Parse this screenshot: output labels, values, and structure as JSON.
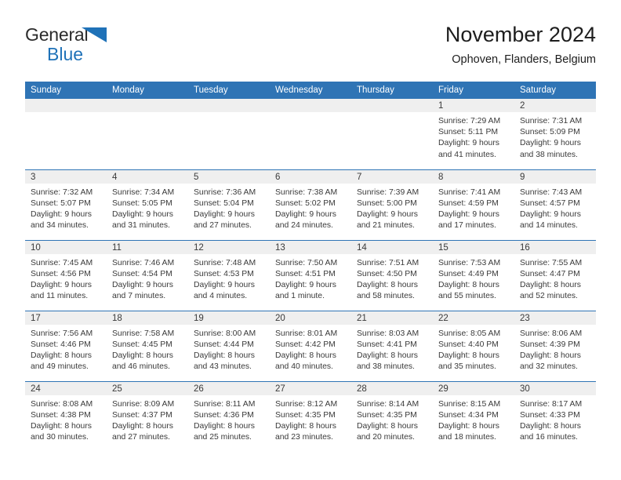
{
  "brand": {
    "line1": "General",
    "line2": "Blue",
    "triangle_color": "#1f72b8"
  },
  "header": {
    "title": "November 2024",
    "subtitle": "Ophoven, Flanders, Belgium"
  },
  "colors": {
    "header_blue": "#2f74b5",
    "daynum_gray": "#efefef",
    "text": "#3a3a3a"
  },
  "weekdays": [
    "Sunday",
    "Monday",
    "Tuesday",
    "Wednesday",
    "Thursday",
    "Friday",
    "Saturday"
  ],
  "labels": {
    "sunrise": "Sunrise:",
    "sunset": "Sunset:",
    "daylight": "Daylight:"
  },
  "weeks": [
    [
      {
        "day": "",
        "empty": true
      },
      {
        "day": "",
        "empty": true
      },
      {
        "day": "",
        "empty": true
      },
      {
        "day": "",
        "empty": true
      },
      {
        "day": "",
        "empty": true
      },
      {
        "day": "1",
        "sunrise": "Sunrise: 7:29 AM",
        "sunset": "Sunset: 5:11 PM",
        "daylight1": "Daylight: 9 hours",
        "daylight2": "and 41 minutes."
      },
      {
        "day": "2",
        "sunrise": "Sunrise: 7:31 AM",
        "sunset": "Sunset: 5:09 PM",
        "daylight1": "Daylight: 9 hours",
        "daylight2": "and 38 minutes."
      }
    ],
    [
      {
        "day": "3",
        "sunrise": "Sunrise: 7:32 AM",
        "sunset": "Sunset: 5:07 PM",
        "daylight1": "Daylight: 9 hours",
        "daylight2": "and 34 minutes."
      },
      {
        "day": "4",
        "sunrise": "Sunrise: 7:34 AM",
        "sunset": "Sunset: 5:05 PM",
        "daylight1": "Daylight: 9 hours",
        "daylight2": "and 31 minutes."
      },
      {
        "day": "5",
        "sunrise": "Sunrise: 7:36 AM",
        "sunset": "Sunset: 5:04 PM",
        "daylight1": "Daylight: 9 hours",
        "daylight2": "and 27 minutes."
      },
      {
        "day": "6",
        "sunrise": "Sunrise: 7:38 AM",
        "sunset": "Sunset: 5:02 PM",
        "daylight1": "Daylight: 9 hours",
        "daylight2": "and 24 minutes."
      },
      {
        "day": "7",
        "sunrise": "Sunrise: 7:39 AM",
        "sunset": "Sunset: 5:00 PM",
        "daylight1": "Daylight: 9 hours",
        "daylight2": "and 21 minutes."
      },
      {
        "day": "8",
        "sunrise": "Sunrise: 7:41 AM",
        "sunset": "Sunset: 4:59 PM",
        "daylight1": "Daylight: 9 hours",
        "daylight2": "and 17 minutes."
      },
      {
        "day": "9",
        "sunrise": "Sunrise: 7:43 AM",
        "sunset": "Sunset: 4:57 PM",
        "daylight1": "Daylight: 9 hours",
        "daylight2": "and 14 minutes."
      }
    ],
    [
      {
        "day": "10",
        "sunrise": "Sunrise: 7:45 AM",
        "sunset": "Sunset: 4:56 PM",
        "daylight1": "Daylight: 9 hours",
        "daylight2": "and 11 minutes."
      },
      {
        "day": "11",
        "sunrise": "Sunrise: 7:46 AM",
        "sunset": "Sunset: 4:54 PM",
        "daylight1": "Daylight: 9 hours",
        "daylight2": "and 7 minutes."
      },
      {
        "day": "12",
        "sunrise": "Sunrise: 7:48 AM",
        "sunset": "Sunset: 4:53 PM",
        "daylight1": "Daylight: 9 hours",
        "daylight2": "and 4 minutes."
      },
      {
        "day": "13",
        "sunrise": "Sunrise: 7:50 AM",
        "sunset": "Sunset: 4:51 PM",
        "daylight1": "Daylight: 9 hours",
        "daylight2": "and 1 minute."
      },
      {
        "day": "14",
        "sunrise": "Sunrise: 7:51 AM",
        "sunset": "Sunset: 4:50 PM",
        "daylight1": "Daylight: 8 hours",
        "daylight2": "and 58 minutes."
      },
      {
        "day": "15",
        "sunrise": "Sunrise: 7:53 AM",
        "sunset": "Sunset: 4:49 PM",
        "daylight1": "Daylight: 8 hours",
        "daylight2": "and 55 minutes."
      },
      {
        "day": "16",
        "sunrise": "Sunrise: 7:55 AM",
        "sunset": "Sunset: 4:47 PM",
        "daylight1": "Daylight: 8 hours",
        "daylight2": "and 52 minutes."
      }
    ],
    [
      {
        "day": "17",
        "sunrise": "Sunrise: 7:56 AM",
        "sunset": "Sunset: 4:46 PM",
        "daylight1": "Daylight: 8 hours",
        "daylight2": "and 49 minutes."
      },
      {
        "day": "18",
        "sunrise": "Sunrise: 7:58 AM",
        "sunset": "Sunset: 4:45 PM",
        "daylight1": "Daylight: 8 hours",
        "daylight2": "and 46 minutes."
      },
      {
        "day": "19",
        "sunrise": "Sunrise: 8:00 AM",
        "sunset": "Sunset: 4:44 PM",
        "daylight1": "Daylight: 8 hours",
        "daylight2": "and 43 minutes."
      },
      {
        "day": "20",
        "sunrise": "Sunrise: 8:01 AM",
        "sunset": "Sunset: 4:42 PM",
        "daylight1": "Daylight: 8 hours",
        "daylight2": "and 40 minutes."
      },
      {
        "day": "21",
        "sunrise": "Sunrise: 8:03 AM",
        "sunset": "Sunset: 4:41 PM",
        "daylight1": "Daylight: 8 hours",
        "daylight2": "and 38 minutes."
      },
      {
        "day": "22",
        "sunrise": "Sunrise: 8:05 AM",
        "sunset": "Sunset: 4:40 PM",
        "daylight1": "Daylight: 8 hours",
        "daylight2": "and 35 minutes."
      },
      {
        "day": "23",
        "sunrise": "Sunrise: 8:06 AM",
        "sunset": "Sunset: 4:39 PM",
        "daylight1": "Daylight: 8 hours",
        "daylight2": "and 32 minutes."
      }
    ],
    [
      {
        "day": "24",
        "sunrise": "Sunrise: 8:08 AM",
        "sunset": "Sunset: 4:38 PM",
        "daylight1": "Daylight: 8 hours",
        "daylight2": "and 30 minutes."
      },
      {
        "day": "25",
        "sunrise": "Sunrise: 8:09 AM",
        "sunset": "Sunset: 4:37 PM",
        "daylight1": "Daylight: 8 hours",
        "daylight2": "and 27 minutes."
      },
      {
        "day": "26",
        "sunrise": "Sunrise: 8:11 AM",
        "sunset": "Sunset: 4:36 PM",
        "daylight1": "Daylight: 8 hours",
        "daylight2": "and 25 minutes."
      },
      {
        "day": "27",
        "sunrise": "Sunrise: 8:12 AM",
        "sunset": "Sunset: 4:35 PM",
        "daylight1": "Daylight: 8 hours",
        "daylight2": "and 23 minutes."
      },
      {
        "day": "28",
        "sunrise": "Sunrise: 8:14 AM",
        "sunset": "Sunset: 4:35 PM",
        "daylight1": "Daylight: 8 hours",
        "daylight2": "and 20 minutes."
      },
      {
        "day": "29",
        "sunrise": "Sunrise: 8:15 AM",
        "sunset": "Sunset: 4:34 PM",
        "daylight1": "Daylight: 8 hours",
        "daylight2": "and 18 minutes."
      },
      {
        "day": "30",
        "sunrise": "Sunrise: 8:17 AM",
        "sunset": "Sunset: 4:33 PM",
        "daylight1": "Daylight: 8 hours",
        "daylight2": "and 16 minutes."
      }
    ]
  ]
}
